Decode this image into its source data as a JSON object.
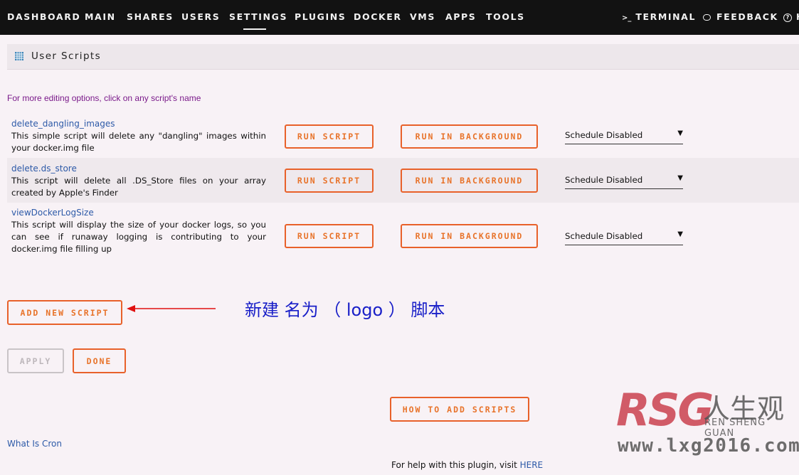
{
  "nav": {
    "items": [
      "DASHBOARD",
      "MAIN",
      "SHARES",
      "USERS",
      "SETTINGS",
      "PLUGINS",
      "DOCKER",
      "VMS",
      "APPS",
      "TOOLS"
    ],
    "active": "SETTINGS",
    "right": [
      {
        "icon": "terminal-icon",
        "glyph": ">_",
        "label": "TERMINAL"
      },
      {
        "icon": "feedback-icon",
        "glyph": "⬭",
        "label": "FEEDBACK"
      },
      {
        "icon": "help-icon",
        "glyph": "?",
        "label": "H"
      }
    ]
  },
  "panel": {
    "title": "User Scripts"
  },
  "hint": "For more editing options, click on any script's name",
  "scripts": [
    {
      "name": "delete_dangling_images",
      "description": "This simple script will delete any \"dangling\" images within your docker.img file",
      "run_label": "RUN SCRIPT",
      "bg_label": "RUN IN BACKGROUND",
      "schedule": "Schedule Disabled"
    },
    {
      "name": "delete.ds_store",
      "description": "This script will delete all .DS_Store files on your array created by Apple's Finder",
      "run_label": "RUN SCRIPT",
      "bg_label": "RUN IN BACKGROUND",
      "schedule": "Schedule Disabled"
    },
    {
      "name": "viewDockerLogSize",
      "description": "This script will display the size of your docker logs, so you can see if runaway logging is contributing to your docker.img file filling up",
      "run_label": "RUN SCRIPT",
      "bg_label": "RUN IN BACKGROUND",
      "schedule": "Schedule Disabled"
    }
  ],
  "buttons": {
    "add_new": "ADD NEW SCRIPT",
    "apply": "APPLY",
    "done": "DONE",
    "how_to": "HOW TO ADD SCRIPTS"
  },
  "annotation": "新建 名为 （ logo ） 脚本",
  "links": {
    "what_is_cron": "What Is Cron",
    "help_prefix": "For help with this plugin, visit ",
    "help_link": "HERE"
  },
  "watermark": {
    "logo": "RSG",
    "cn": "人生观",
    "sub": "REN SHENG GUAN",
    "url": "www.lxg2016.com"
  },
  "colors": {
    "accent": "#e8612a",
    "link": "#2d5aa8",
    "annotation": "#1a20c8",
    "arrow": "#e01010"
  }
}
